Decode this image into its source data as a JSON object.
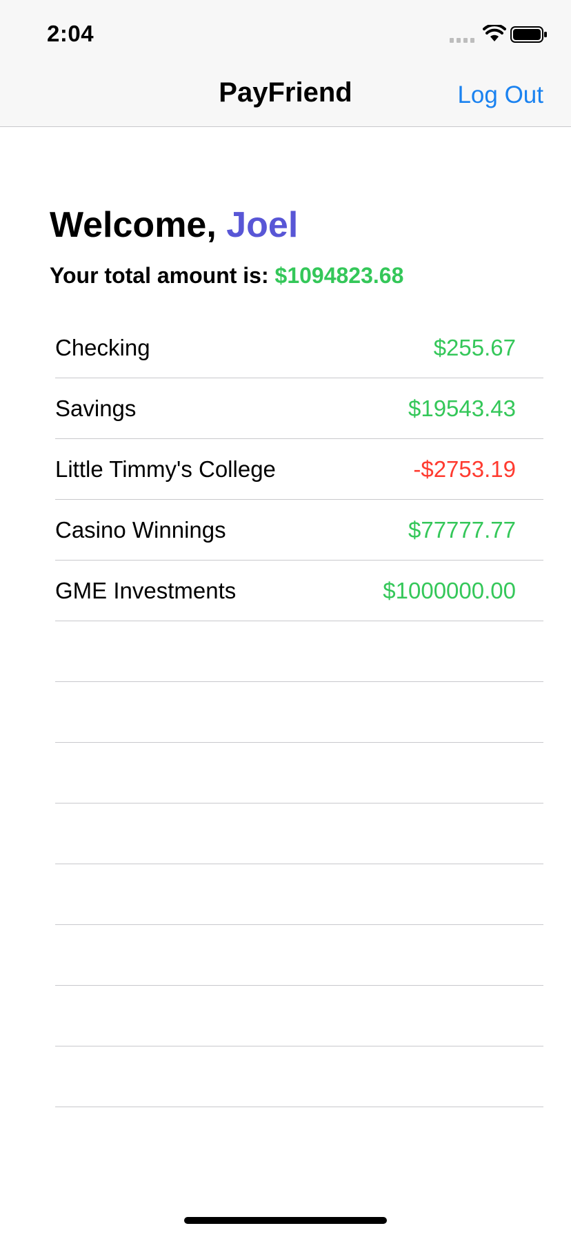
{
  "status": {
    "time": "2:04",
    "icons": [
      "signal-icon",
      "wifi-icon",
      "battery-icon"
    ]
  },
  "nav": {
    "title": "PayFriend",
    "logout_label": "Log Out"
  },
  "welcome": {
    "greeting": "Welcome, ",
    "name": "Joel"
  },
  "total": {
    "label": "Your total amount is: ",
    "amount": "$1094823.68"
  },
  "accounts": [
    {
      "name": "Checking",
      "balance": "$255.67"
    },
    {
      "name": "Savings",
      "balance": "$19543.43"
    },
    {
      "name": "Little Timmy's College",
      "balance": "-$2753.19"
    },
    {
      "name": "Casino Winnings",
      "balance": "$77777.77"
    },
    {
      "name": "GME Investments",
      "balance": "$1000000.00"
    }
  ],
  "colors": {
    "positive": "#34c759",
    "negative": "#ff3b30",
    "accent": "#1a82f0",
    "name": "#5856d6"
  }
}
